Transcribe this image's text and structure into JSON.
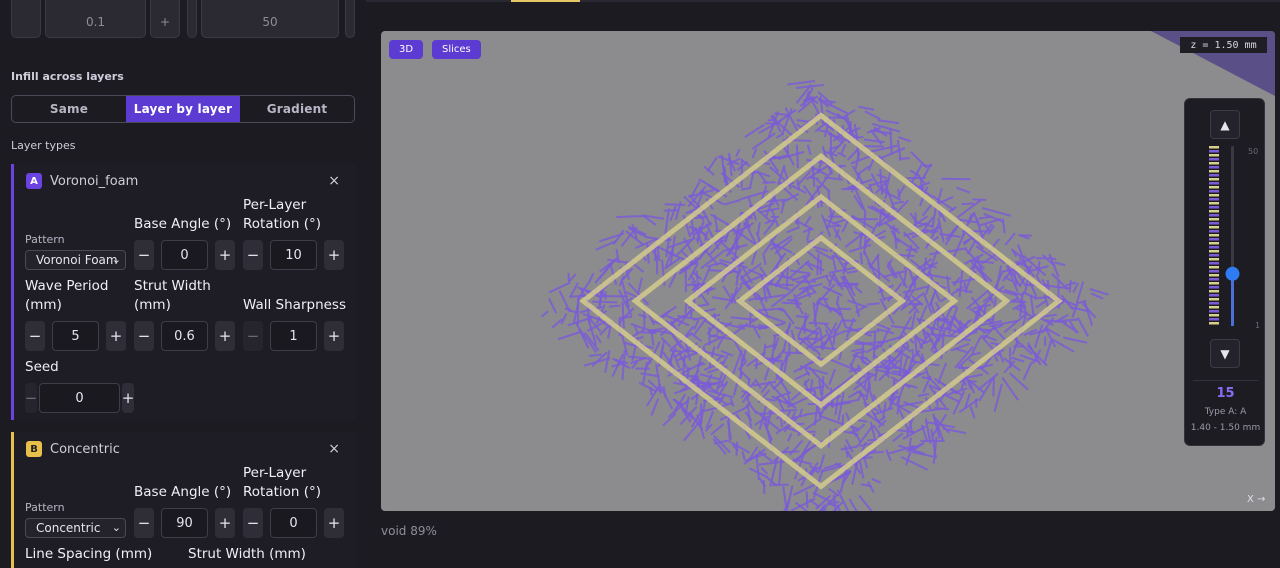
{
  "top_stub": {
    "left_value": "0.1",
    "plus": "+",
    "right_value": "50"
  },
  "infill": {
    "label": "Infill across layers",
    "tabs": [
      {
        "label": "Same",
        "active": false
      },
      {
        "label": "Layer by layer",
        "active": true
      },
      {
        "label": "Gradient",
        "active": false
      }
    ]
  },
  "layer_types_label": "Layer types",
  "layers": [
    {
      "badge": "A",
      "name": "Voronoi_foam",
      "close": "×",
      "pattern_label": "Pattern",
      "pattern_value": "Voronoi Foam",
      "base_angle_label": "Base Angle (°)",
      "base_angle": "0",
      "per_layer_label_1": "Per-Layer",
      "per_layer_label_2": "Rotation (°)",
      "per_layer": "10",
      "wave_period_label_1": "Wave Period",
      "wave_period_label_2": "(mm)",
      "wave_period": "5",
      "strut_width_label_1": "Strut Width",
      "strut_width_label_2": "(mm)",
      "strut_width": "0.6",
      "wall_sharpness_label": "Wall Sharpness",
      "wall_sharpness": "1",
      "seed_label": "Seed",
      "seed": "0"
    },
    {
      "badge": "B",
      "name": "Concentric",
      "close": "×",
      "pattern_label": "Pattern",
      "pattern_value": "Concentric",
      "base_angle_label": "Base Angle (°)",
      "base_angle": "90",
      "per_layer_label_1": "Per-Layer",
      "per_layer_label_2": "Rotation (°)",
      "per_layer": "0",
      "line_spacing_label": "Line Spacing (mm)",
      "strut_width_label": "Strut Width (mm)"
    }
  ],
  "stepper": {
    "minus": "−",
    "plus": "+"
  },
  "viewport": {
    "btn_3d": "3D",
    "btn_slices": "Slices",
    "z_readout": "z = 1.50 mm",
    "x_axis": "X →",
    "void": "void 89%",
    "colors": {
      "type_a": "#7a5cd6",
      "type_b": "#d9cf8c",
      "bg": "#8c8b8e"
    }
  },
  "layer_slider": {
    "up": "▲",
    "down": "▼",
    "max": "50",
    "min": "1",
    "current": "15",
    "current_fraction": 0.29,
    "type_text": "Type A: A",
    "range_text": "1.40 - 1.50 mm"
  }
}
